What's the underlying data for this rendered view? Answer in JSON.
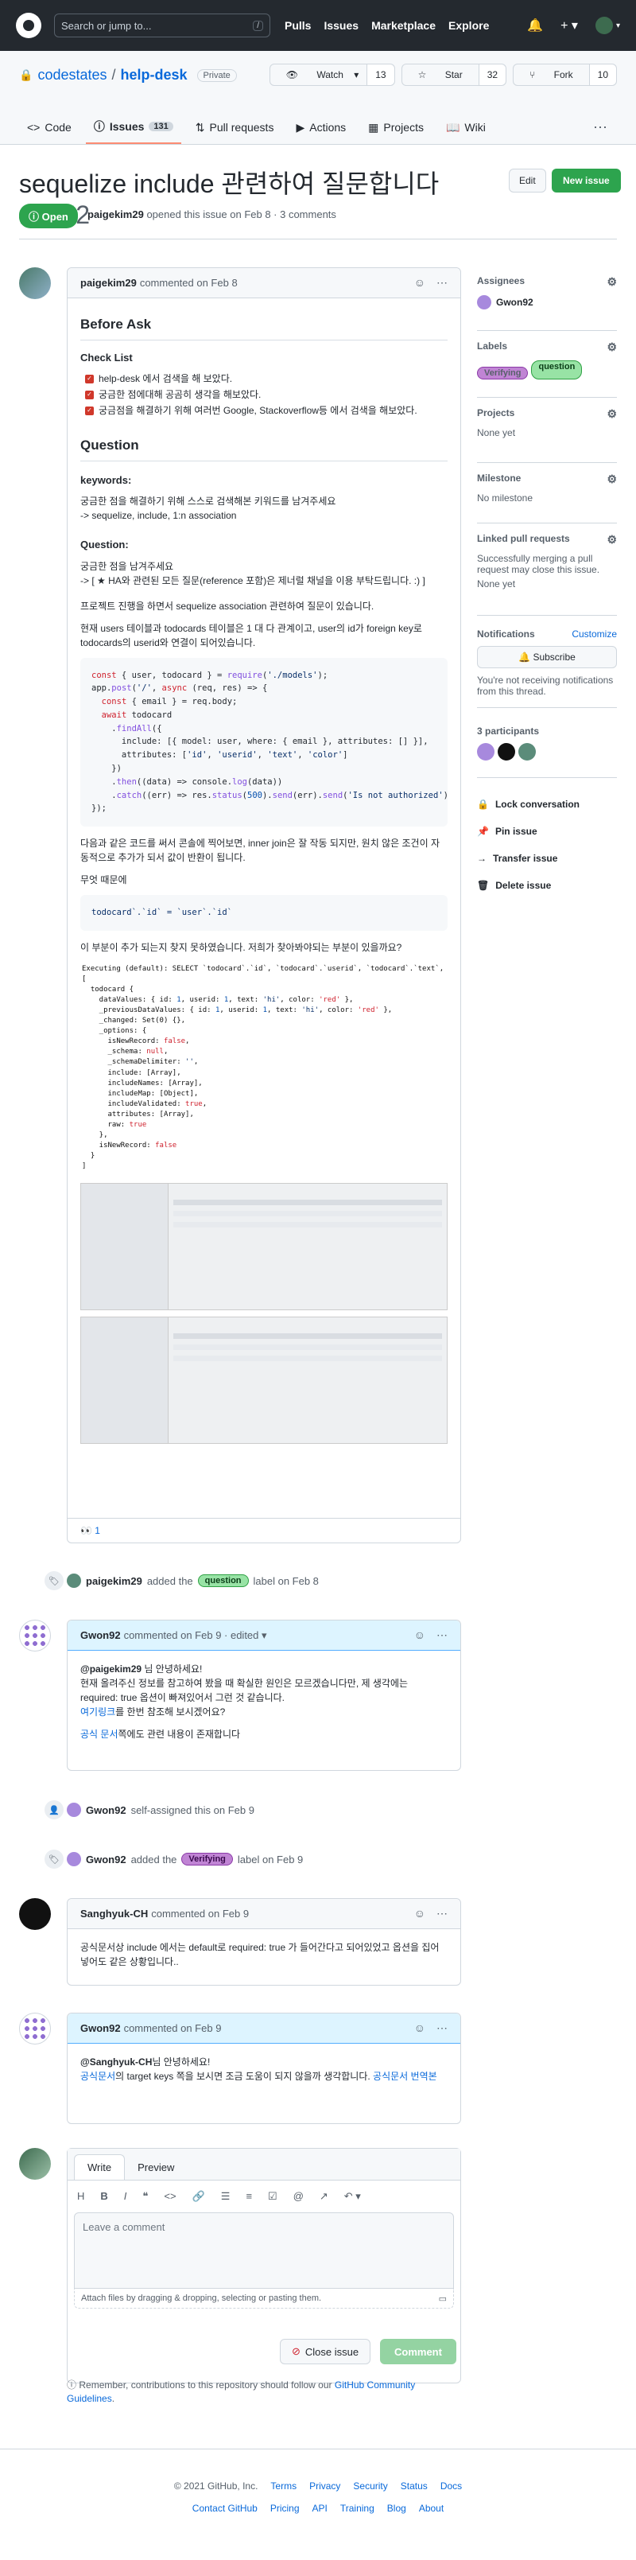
{
  "header": {
    "search_placeholder": "Search or jump to...",
    "search_key": "/",
    "nav": [
      "Pulls",
      "Issues",
      "Marketplace",
      "Explore"
    ]
  },
  "repo": {
    "owner": "codestates",
    "sep": "/",
    "name": "help-desk",
    "visibility": "Private",
    "watch_label": "Watch",
    "watch_count": "13",
    "star_label": "Star",
    "star_count": "32",
    "fork_label": "Fork",
    "fork_count": "10",
    "tabs": [
      {
        "label": "Code"
      },
      {
        "label": "Issues",
        "count": "131"
      },
      {
        "label": "Pull requests"
      },
      {
        "label": "Actions"
      },
      {
        "label": "Projects"
      },
      {
        "label": "Wiki"
      }
    ]
  },
  "issue": {
    "title": "sequelize include 관련하여 질문합니다",
    "number": "#2752",
    "edit_label": "Edit",
    "new_label": "New issue",
    "state": "Open",
    "author": "paigekim29",
    "meta_text": "opened this issue on Feb 8 · 3 comments"
  },
  "first_comment": {
    "author": "paigekim29",
    "when": "commented on Feb 8",
    "before_ask": "Before Ask",
    "checklist_title": "Check List",
    "checks": [
      "help-desk 에서 검색을 해 보았다.",
      "궁금한 점에대해 공곰히 생각을 해보았다.",
      "궁금점을 해결하기 위해 여러번 Google, Stackoverflow등 에서 검색을 해보았다."
    ],
    "question_title": "Question",
    "keywords_title": "keywords:",
    "keywords_text1": "궁금한 점을 해결하기 위해 스스로 검색해본 키워드를 남겨주세요",
    "keywords_text2": "-> sequelize, include, 1:n association",
    "q_title": "Question:",
    "q_text1": "궁금한 점을 남겨주세요",
    "q_text2": "-> [ ★ HA와 관련된 모든 질문(reference 포함)은 제너럴 채널을 이용 부탁드립니다. :) ]",
    "p1": "프로젝트 진행을 하면서 sequelize association 관련하여 질문이 있습니다.",
    "p2": "현재 users 테이블과 todocards 테이블은 1 대 다 관계이고, user의 id가 foreign key로 todocards의 userid와 연결이 되어있습니다.",
    "p3": "다음과 같은 코드를 써서 콘솔에 찍어보면, inner join은 잘 작동 되지만, 원치 않은 조건이 자동적으로 추가가 되서 값이 반환이 됩니다.",
    "p4": "무엇 때문에",
    "code2": "todocard`.`id` = `user`.`id`",
    "p5": "이 부분이 추가 되는지 찾지 못하였습니다. 저희가 찾아봐야되는 부분이 있을까요?",
    "reaction": "👀 1"
  },
  "events": {
    "e1_user": "paigekim29",
    "e1_text": "added the",
    "e1_label": "question",
    "e1_tail": "label on Feb 8",
    "e2_user": "Gwon92",
    "e2_text": "self-assigned this on Feb 9",
    "e3_user": "Gwon92",
    "e3_text": "added the",
    "e3_label": "Verifying",
    "e3_tail": "label on Feb 9"
  },
  "comment2": {
    "author": "Gwon92",
    "when": "commented on Feb 9 · edited",
    "l1_mention": "@paigekim29",
    "l1_rest": " 님 안녕하세요!",
    "l2": "현재 올려주신 정보를 참고하여 봤을 때 확실한 원인은 모르겠습니다만, 제 생각에는 required: true 옵션이 빠져있어서 그런 것 같습니다.",
    "l3_link": "여기링크",
    "l3_rest": "를 한번 참조해 보시겠어요?",
    "l4_link": "공식 문서",
    "l4_rest": "쪽에도 관련 내용이 존재합니다"
  },
  "comment3": {
    "author": "Sanghyuk-CH",
    "when": "commented on Feb 9",
    "text": "공식문서상 include 에서는 default로 required: true 가 들어간다고 되어있었고 옵션을 집어넣어도 같은 상황입니다.."
  },
  "comment4": {
    "author": "Gwon92",
    "when": "commented on Feb 9",
    "l1_mention": "@Sanghyuk-CH",
    "l1_rest": "님 안녕하세요!",
    "l2_link": "공식문서",
    "l2_rest": "의 target keys 쪽을 보시면 조금 도움이 되지 않을까 생각합니다. ",
    "l2_link2": "공식문서 번역본"
  },
  "editor": {
    "tab_write": "Write",
    "tab_preview": "Preview",
    "placeholder": "Leave a comment",
    "attach": "Attach files by dragging & dropping, selecting or pasting them.",
    "close_label": "Close issue",
    "comment_label": "Comment",
    "remind_pre": "Remember, contributions to this repository should follow our ",
    "remind_link": "GitHub Community Guidelines",
    "remind_post": "."
  },
  "sidebar": {
    "assignees_title": "Assignees",
    "assignee": "Gwon92",
    "labels_title": "Labels",
    "labels": [
      "Verifying",
      "question"
    ],
    "projects_title": "Projects",
    "projects_value": "None yet",
    "milestone_title": "Milestone",
    "milestone_value": "No milestone",
    "linked_title": "Linked pull requests",
    "linked_value": "Successfully merging a pull request may close this issue.",
    "linked_value2": "None yet",
    "notif_title": "Notifications",
    "customize": "Customize",
    "subscribe": "Subscribe",
    "notif_value": "You're not receiving notifications from this thread.",
    "participants": "3 participants",
    "actions": [
      "Lock conversation",
      "Pin issue",
      "Transfer issue",
      "Delete issue"
    ]
  },
  "footer": {
    "copyright": "© 2021 GitHub, Inc.",
    "row1": [
      "Terms",
      "Privacy",
      "Security",
      "Status",
      "Docs"
    ],
    "row2": [
      "Contact GitHub",
      "Pricing",
      "API",
      "Training",
      "Blog",
      "About"
    ]
  },
  "colors": {
    "accent": "#0969da",
    "open_green": "#2da44e",
    "question_label": "#98e3a5",
    "verifying_label": "#c084d4"
  }
}
